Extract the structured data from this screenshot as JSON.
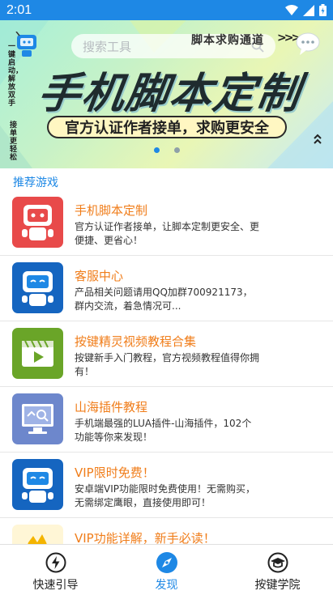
{
  "status_bar": {
    "time": "2:01",
    "wifi_icon": "wifi-icon",
    "signal_icon": "signal-icon",
    "battery_icon": "battery-icon"
  },
  "banner": {
    "search_placeholder": "搜索工具",
    "channel_text": "脚本求购通道",
    "arrows_text": ">>>",
    "title": "手机脚本定制",
    "subtitle": "官方认证作者接单，求购更安全",
    "vertical_left": "接单更轻松",
    "vertical_mid": "一键启动，解放双手",
    "dots": [
      true,
      false
    ]
  },
  "section": {
    "label": "推荐游戏"
  },
  "list_items": [
    {
      "title": "手机脚本定制",
      "desc": "官方认证作者接单，让脚本定制更安全、更便捷、更省心！",
      "icon": "robot-red-icon"
    },
    {
      "title": "客服中心",
      "desc": "产品相关问题请用QQ加群700921173，群内交流，着急情况可...",
      "icon": "robot-blue-icon"
    },
    {
      "title": "按键精灵视频教程合集",
      "desc": "按键新手入门教程，官方视频教程值得你拥有！",
      "icon": "video-play-icon"
    },
    {
      "title": "山海插件教程",
      "desc": "手机端最强的LUA插件-山海插件，102个功能等你来发现！",
      "icon": "computer-search-icon"
    },
    {
      "title": "VIP限时免费！",
      "desc": "安卓端VIP功能限时免费使用！无需购买，无需绑定鹰眼，直接使用即可！",
      "icon": "robot-blue-icon"
    },
    {
      "title": "VIP功能详解，新手必读！",
      "desc": "",
      "icon": "vip-crown-icon"
    }
  ],
  "bottom_nav": [
    {
      "label": "快速引导",
      "icon": "lightning-icon",
      "active": false
    },
    {
      "label": "发现",
      "icon": "compass-icon",
      "active": true
    },
    {
      "label": "按键学院",
      "icon": "graduation-cap-icon",
      "active": false
    }
  ],
  "colors": {
    "primary": "#1e88e5",
    "title_orange": "#f07d1a",
    "red_icon": "#e84a4a",
    "blue_icon": "#1565c0",
    "green_icon": "#6aa528",
    "purple_icon": "#6d87cc"
  }
}
